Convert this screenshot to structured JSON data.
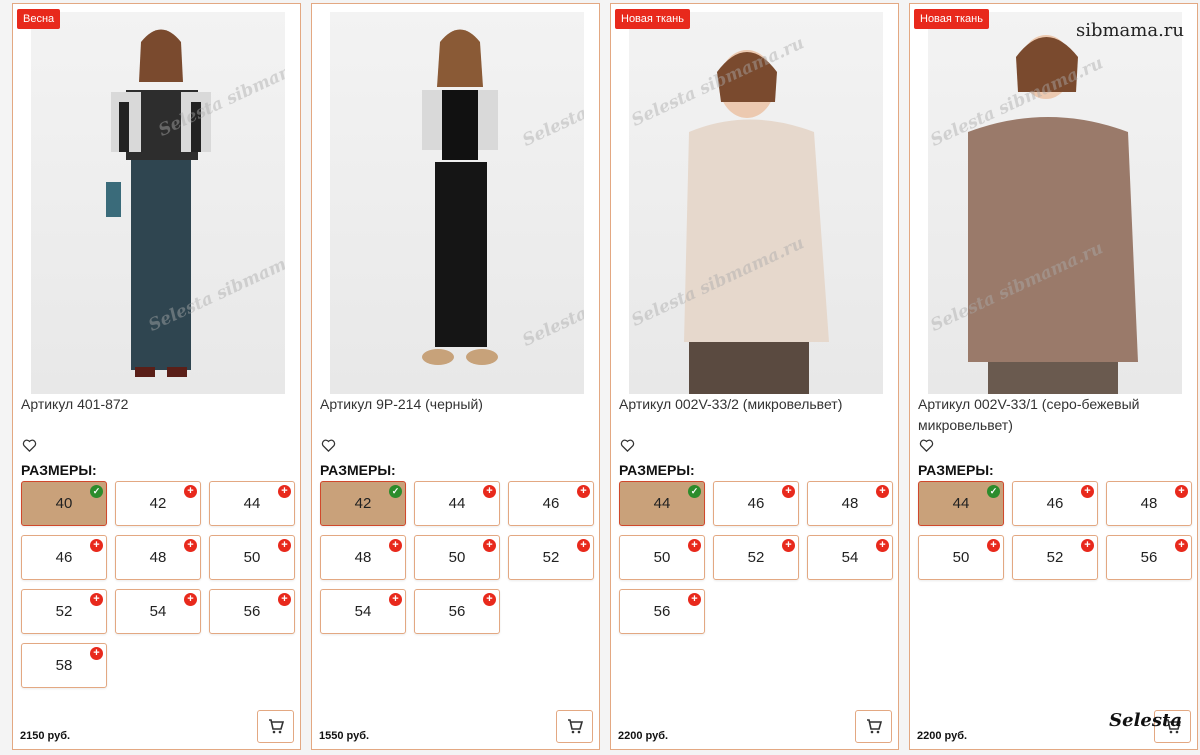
{
  "site": "sibmama.ru",
  "watermark": "Selesta sibmama.ru",
  "brand_signature": "Selesta",
  "sizes_label": "РАЗМЕРЫ:",
  "colors": {
    "accent": "#e8291c",
    "selected": "#c9a17a",
    "border": "#e3a882",
    "ok": "#2c8c2c"
  },
  "products": [
    {
      "badge": "Весна",
      "title": "Артикул 401-872",
      "price": "2150 руб.",
      "sizes": [
        {
          "label": "40",
          "state": "selected"
        },
        {
          "label": "42",
          "state": "add"
        },
        {
          "label": "44",
          "state": "add"
        },
        {
          "label": "46",
          "state": "add"
        },
        {
          "label": "48",
          "state": "add"
        },
        {
          "label": "50",
          "state": "add"
        },
        {
          "label": "52",
          "state": "add"
        },
        {
          "label": "54",
          "state": "add"
        },
        {
          "label": "56",
          "state": "add"
        },
        {
          "label": "58",
          "state": "add"
        }
      ]
    },
    {
      "badge": "",
      "title": "Артикул 9P-214 (черный)",
      "price": "1550 руб.",
      "sizes": [
        {
          "label": "42",
          "state": "selected"
        },
        {
          "label": "44",
          "state": "add"
        },
        {
          "label": "46",
          "state": "add"
        },
        {
          "label": "48",
          "state": "add"
        },
        {
          "label": "50",
          "state": "add"
        },
        {
          "label": "52",
          "state": "add"
        },
        {
          "label": "54",
          "state": "add"
        },
        {
          "label": "56",
          "state": "add"
        }
      ]
    },
    {
      "badge": "Новая ткань",
      "title": "Артикул 002V-33/2 (микровельвет)",
      "price": "2200 руб.",
      "sizes": [
        {
          "label": "44",
          "state": "selected"
        },
        {
          "label": "46",
          "state": "add"
        },
        {
          "label": "48",
          "state": "add"
        },
        {
          "label": "50",
          "state": "add"
        },
        {
          "label": "52",
          "state": "add"
        },
        {
          "label": "54",
          "state": "add"
        },
        {
          "label": "56",
          "state": "add"
        }
      ]
    },
    {
      "badge": "Новая ткань",
      "title": "Артикул 002V-33/1 (серо-бежевый микровельвет)",
      "price": "2200 руб.",
      "sizes": [
        {
          "label": "44",
          "state": "selected"
        },
        {
          "label": "46",
          "state": "add"
        },
        {
          "label": "48",
          "state": "add"
        },
        {
          "label": "50",
          "state": "add"
        },
        {
          "label": "52",
          "state": "add"
        },
        {
          "label": "56",
          "state": "add"
        }
      ]
    }
  ]
}
